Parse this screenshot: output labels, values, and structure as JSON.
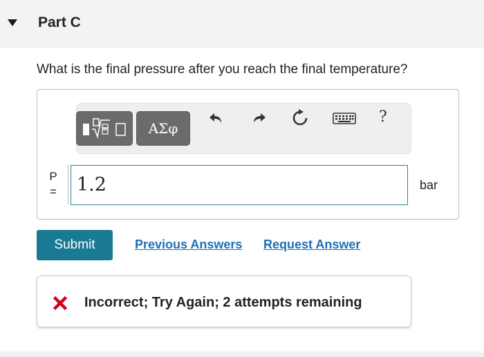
{
  "part": {
    "title": "Part C"
  },
  "question": {
    "text": "What is the final pressure after you reach the final temperature?"
  },
  "toolbar": {
    "templates_icon": "templates-sqrt-icon",
    "symbols_label": "ΑΣφ",
    "undo_icon": "undo-icon",
    "redo_icon": "redo-icon",
    "reset_icon": "reset-icon",
    "keyboard_icon": "keyboard-icon",
    "help_label": "?"
  },
  "answer": {
    "variable": "P",
    "equals": "=",
    "value": "1.2",
    "unit": "bar"
  },
  "actions": {
    "submit_label": "Submit",
    "previous_answers_label": "Previous Answers",
    "request_answer_label": "Request Answer"
  },
  "feedback": {
    "message": "Incorrect; Try Again; 2 attempts remaining",
    "status_color": "#d0021b"
  },
  "colors": {
    "submit_bg": "#1a7a94",
    "link": "#1f6fb6",
    "input_border": "#2f7f8f"
  }
}
